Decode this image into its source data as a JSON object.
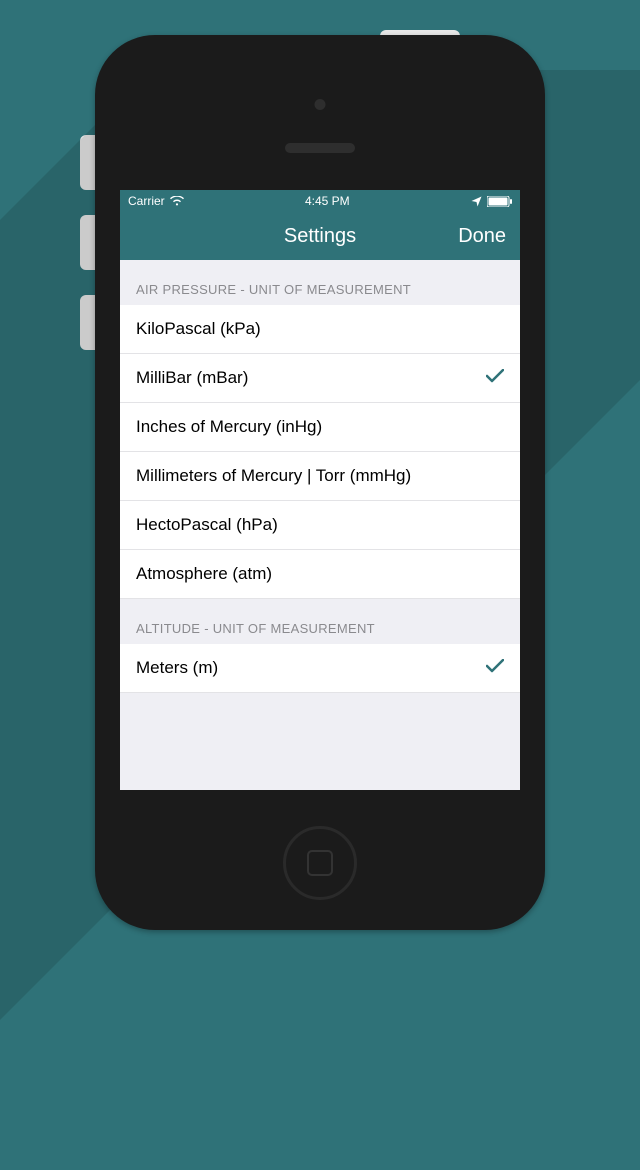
{
  "statusBar": {
    "carrier": "Carrier",
    "time": "4:45 PM"
  },
  "nav": {
    "title": "Settings",
    "done": "Done"
  },
  "sections": {
    "pressure": {
      "header": "AIR PRESSURE - UNIT OF MEASUREMENT",
      "items": {
        "kpa": "KiloPascal (kPa)",
        "mbar": "MilliBar (mBar)",
        "inhg": "Inches of Mercury (inHg)",
        "mmhg": "Millimeters of Mercury | Torr (mmHg)",
        "hpa": "HectoPascal (hPa)",
        "atm": "Atmosphere (atm)"
      },
      "selected": "mbar"
    },
    "altitude": {
      "header": "ALTITUDE - UNIT OF MEASUREMENT",
      "items": {
        "m": "Meters (m)"
      },
      "selected": "m"
    }
  }
}
